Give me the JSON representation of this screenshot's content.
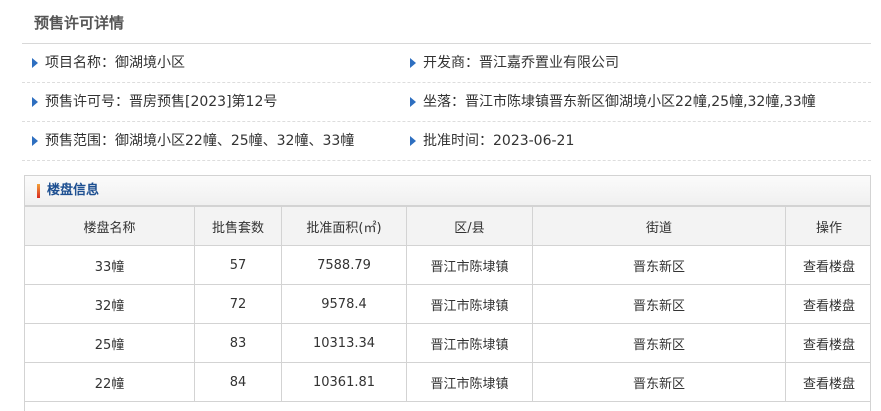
{
  "page": {
    "title": "预售许可详情"
  },
  "info": {
    "project_name": "项目名称：御湖境小区",
    "developer": "开发商：晋江嘉乔置业有限公司",
    "permit_no": "预售许可号：晋房预售[2023]第12号",
    "location": "坐落：晋江市陈埭镇晋东新区御湖境小区22幢,25幢,32幢,33幢",
    "scope": "预售范围：御湖境小区22幢、25幢、32幢、33幢",
    "approval_date": "批准时间：2023-06-21"
  },
  "buildings": {
    "title": "楼盘信息",
    "columns": [
      "楼盘名称",
      "批售套数",
      "批准面积(㎡)",
      "区/县",
      "街道",
      "操作"
    ],
    "rows": [
      {
        "name": "33幢",
        "units": "57",
        "area": "7588.79",
        "district": "晋江市陈埭镇",
        "street": "晋东新区",
        "action": "查看楼盘"
      },
      {
        "name": "32幢",
        "units": "72",
        "area": "9578.4",
        "district": "晋江市陈埭镇",
        "street": "晋东新区",
        "action": "查看楼盘"
      },
      {
        "name": "25幢",
        "units": "83",
        "area": "10313.34",
        "district": "晋江市陈埭镇",
        "street": "晋东新区",
        "action": "查看楼盘"
      },
      {
        "name": "22幢",
        "units": "84",
        "area": "10361.81",
        "district": "晋江市陈埭镇",
        "street": "晋东新区",
        "action": "查看楼盘"
      }
    ]
  },
  "icons": {
    "bullet": "triangle-right-icon",
    "panel_marker": "title-bar-icon"
  },
  "colors": {
    "bullet": "#2e6fc0",
    "panel_title": "#1d4f91",
    "panel_marker_top": "#f2a23a",
    "panel_marker_bottom": "#d9281f"
  }
}
